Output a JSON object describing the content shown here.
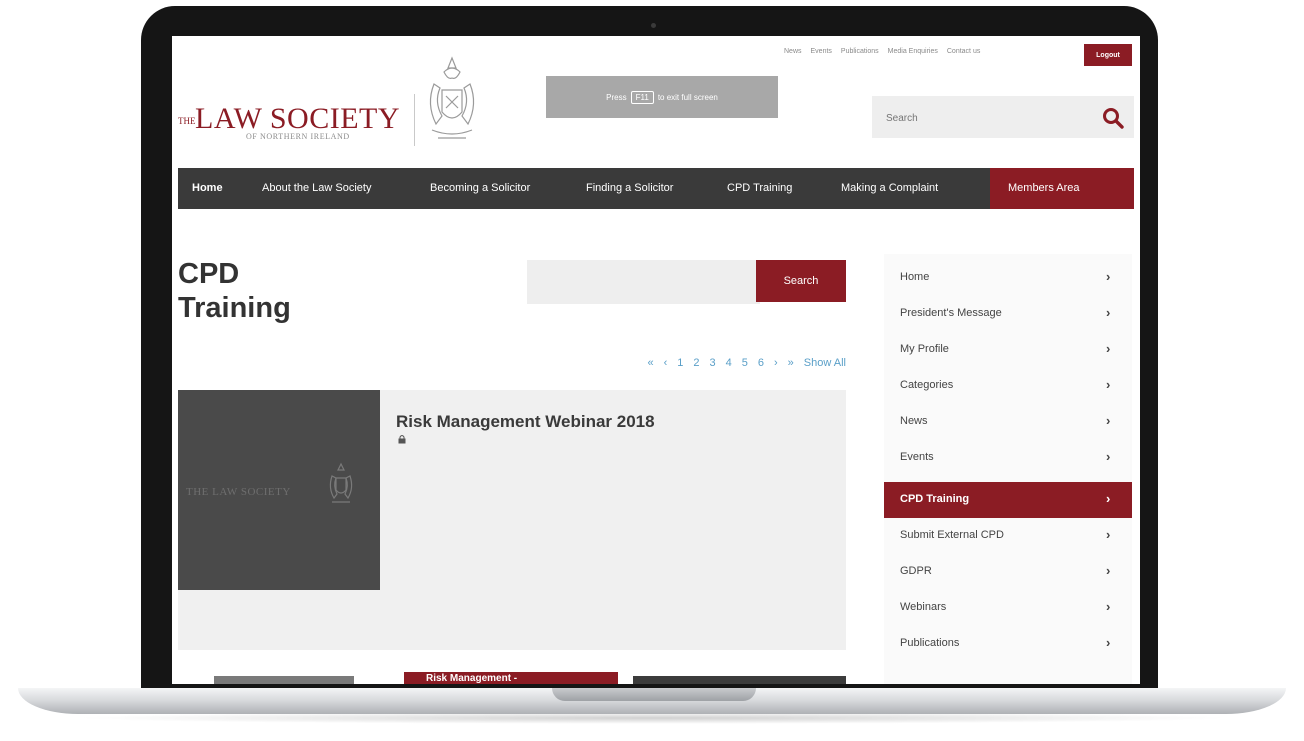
{
  "header": {
    "top_links": [
      "News",
      "Events",
      "Publications",
      "Media Enquiries",
      "Contact us"
    ],
    "logout_label": "Logout",
    "logo_prefix": "THE",
    "logo_name": "LAW SOCIETY",
    "logo_sub": "OF NORTHERN IRELAND",
    "fullscreen_prefix": "Press",
    "fullscreen_key": "F11",
    "fullscreen_suffix": "to exit full screen",
    "search_placeholder": "Search"
  },
  "nav": {
    "items": [
      {
        "label": "Home",
        "active": true
      },
      {
        "label": "About the Law Society"
      },
      {
        "label": "Becoming a Solicitor"
      },
      {
        "label": "Finding a Solicitor"
      },
      {
        "label": "CPD Training"
      },
      {
        "label": "Making a Complaint"
      },
      {
        "label": "Members Area",
        "highlight": true
      }
    ]
  },
  "main": {
    "title_line1": "CPD",
    "title_line2": "Training",
    "search_button": "Search",
    "pagination": [
      "«",
      "‹",
      "1",
      "2",
      "3",
      "4",
      "5",
      "6",
      "›",
      "»",
      "Show All"
    ],
    "card": {
      "title": "Risk Management Webinar 2018",
      "thumb_logo": "THE LAW SOCIETY"
    },
    "next_card_label": "Risk Management - "
  },
  "sidebar": {
    "items": [
      {
        "label": "Home"
      },
      {
        "label": "President's Message"
      },
      {
        "label": "My Profile"
      },
      {
        "label": "Categories"
      },
      {
        "label": "News"
      },
      {
        "label": "Events"
      },
      {
        "label": "CPD Training",
        "active": true
      },
      {
        "label": "Submit External CPD"
      },
      {
        "label": "GDPR"
      },
      {
        "label": "Webinars"
      },
      {
        "label": "Publications"
      }
    ],
    "chevron": "›"
  },
  "colors": {
    "brand": "#8b1c24",
    "nav_bg": "#3a3a3a",
    "link": "#5a9fc8"
  }
}
